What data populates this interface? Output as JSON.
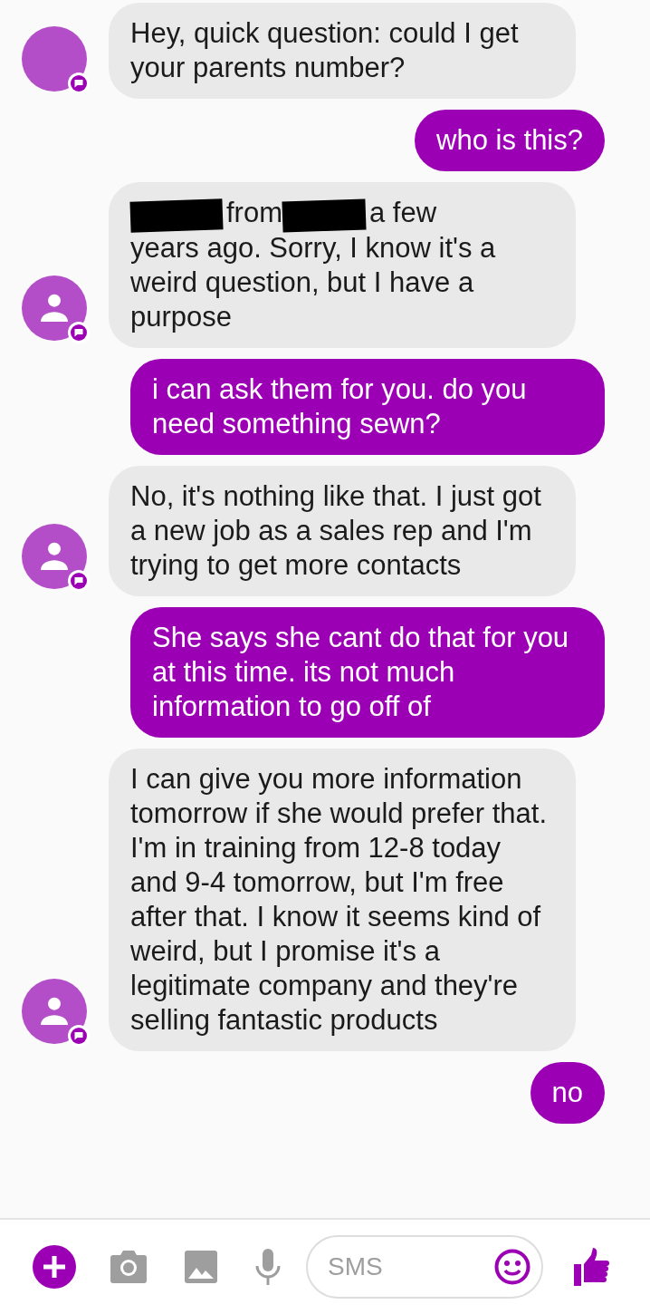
{
  "messages": [
    {
      "kind": "received",
      "avatar": {
        "kind": "blank"
      },
      "parts": [
        {
          "kind": "text",
          "text": "Hey, quick question: could I get your parents number?"
        }
      ]
    },
    {
      "kind": "sent",
      "parts": [
        {
          "kind": "text",
          "text": "who is this?"
        }
      ]
    },
    {
      "kind": "received",
      "avatar": {
        "kind": "person"
      },
      "parts": [
        {
          "kind": "redaction"
        },
        {
          "kind": "text",
          "text": "from"
        },
        {
          "kind": "redaction"
        },
        {
          "kind": "text",
          "text": "a few"
        },
        {
          "kind": "paragraph",
          "text": "years ago. Sorry, I know it's a weird question, but I have a purpose"
        }
      ]
    },
    {
      "kind": "sent",
      "parts": [
        {
          "kind": "text",
          "text": "i can ask them for you. do you need something sewn?"
        }
      ]
    },
    {
      "kind": "received",
      "avatar": {
        "kind": "person"
      },
      "parts": [
        {
          "kind": "text",
          "text": "No, it's nothing like that. I just got a new job as a sales rep and I'm trying to get more contacts"
        }
      ]
    },
    {
      "kind": "sent",
      "parts": [
        {
          "kind": "text",
          "text": "She says she cant do that for you at this time. its not much information to go off of"
        }
      ]
    },
    {
      "kind": "received",
      "avatar": {
        "kind": "person"
      },
      "parts": [
        {
          "kind": "text",
          "text": "I can give you more information tomorrow if she would prefer that. I'm in training from 12-8 today and 9-4 tomorrow, but I'm free after that. I know it seems kind of weird, but I promise it's a legitimate company and they're selling fantastic products"
        }
      ]
    },
    {
      "kind": "sent",
      "parts": [
        {
          "kind": "text",
          "text": "no"
        }
      ]
    }
  ],
  "composer": {
    "placeholder": "SMS"
  }
}
